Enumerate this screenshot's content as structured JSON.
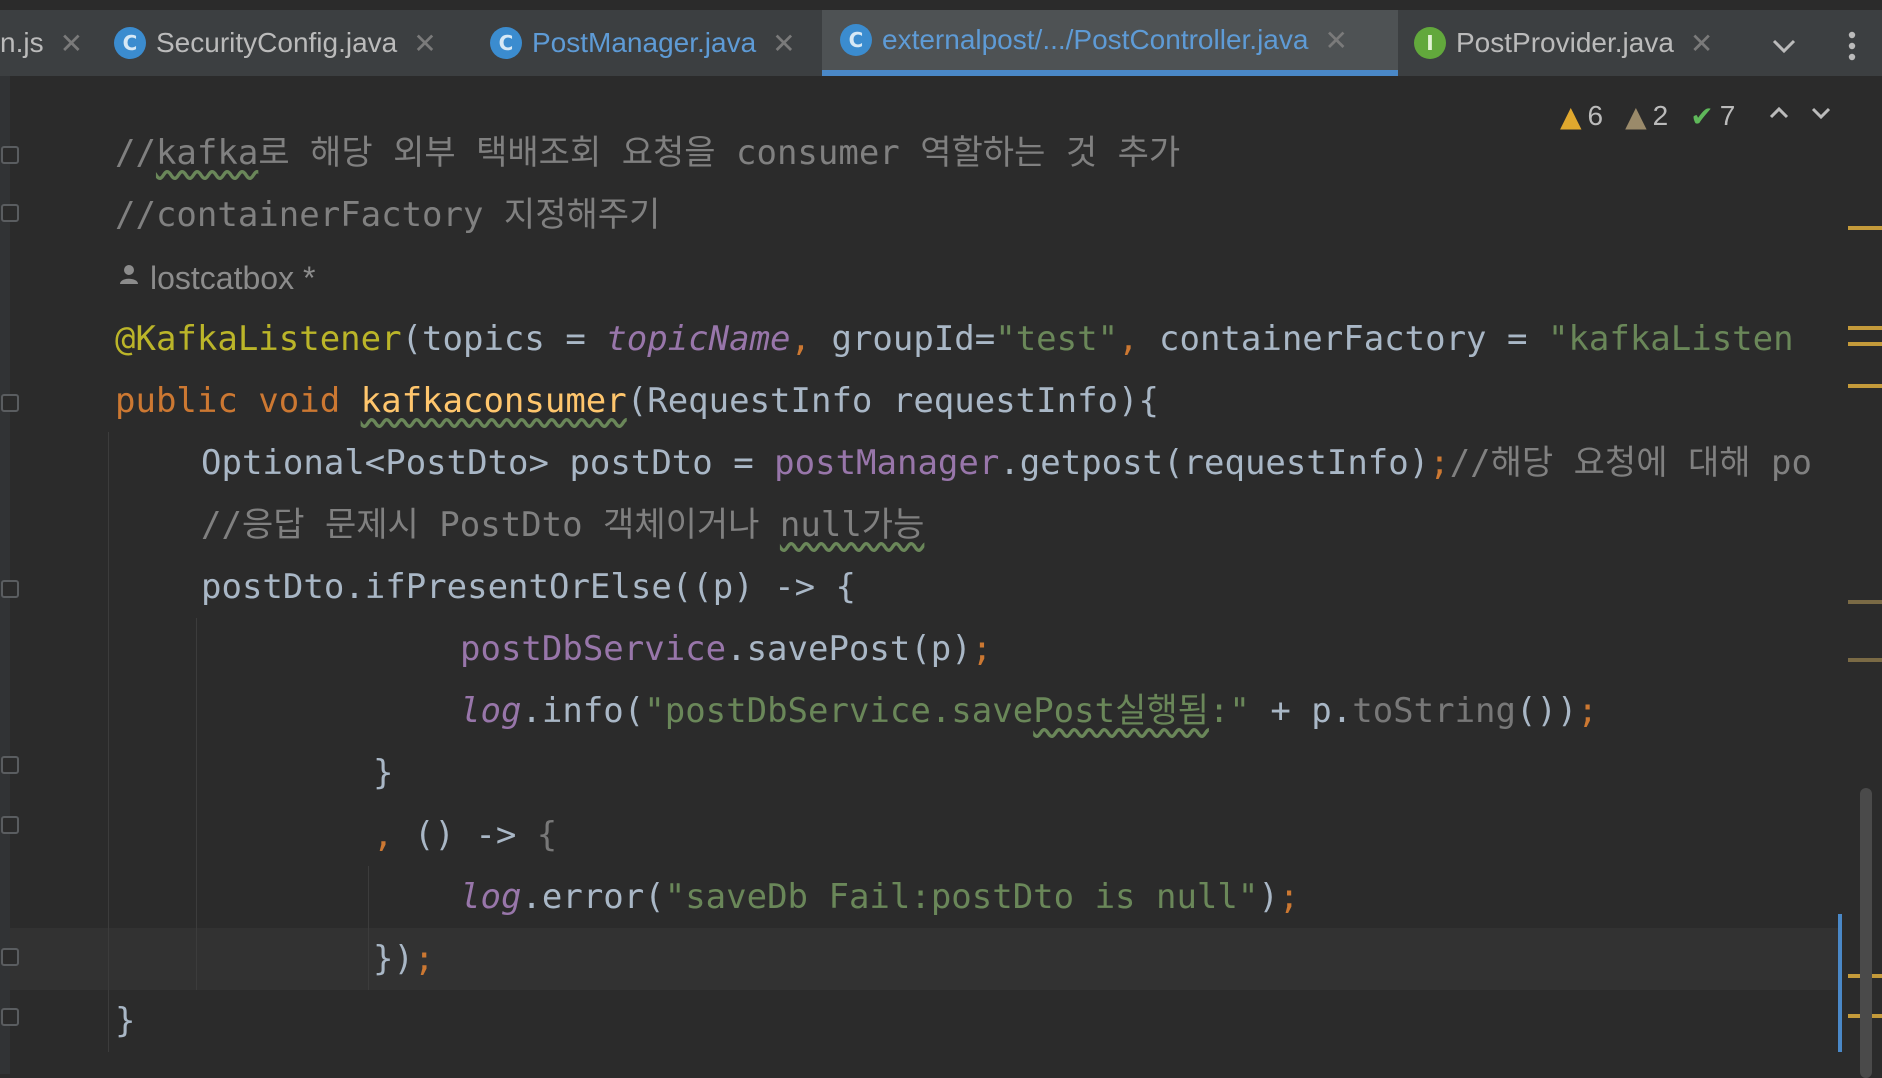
{
  "tabs": [
    {
      "label": "n.js",
      "badge": ""
    },
    {
      "label": "SecurityConfig.java",
      "badge": "C"
    },
    {
      "label": "PostManager.java",
      "badge": "C"
    },
    {
      "label": "externalpost/.../PostController.java",
      "badge": "C"
    },
    {
      "label": "PostProvider.java",
      "badge": "I"
    }
  ],
  "tab_close_glyph": "✕",
  "icons": {
    "tab_menu": "chevron-down-icon",
    "more": "more-vertical-icon",
    "inspect_up": "chevron-up-icon",
    "inspect_down": "chevron-down-icon",
    "author": "person-icon"
  },
  "inspections": {
    "warnings": "6",
    "weak_warnings": "2",
    "typos": "7"
  },
  "author": "lostcatbox *",
  "code": {
    "l1_a": "//",
    "l1_b": "kafka",
    "l1_c": "로 해당 외부 택배조회 요청을 consumer 역할하는 것 추가",
    "l2": "//containerFactory 지정해주기",
    "l4_ann": "@KafkaListener",
    "l4_a": "(topics = ",
    "l4_topic": "topicName",
    "l4_comma1": ", ",
    "l4_b": "groupId=",
    "l4_str1": "\"test\"",
    "l4_comma2": ", ",
    "l4_c": "containerFactory = ",
    "l4_str2": "\"kafkaListen",
    "l5_kw": "public void ",
    "l5_fn": "kafkaconsumer",
    "l5_rest": "(RequestInfo requestInfo){",
    "l6_a": "Optional<PostDto> postDto = ",
    "l6_fld": "postManager",
    "l6_b": ".getpost(requestInfo)",
    "l6_semi": ";",
    "l6_cmt": "//해당 요청에 대해 po",
    "l7_a": "//응답 문제시 PostDto 객체이거나 ",
    "l7_b": "null가능",
    "l8": "postDto.ifPresentOrElse((p) -> {",
    "l9_fld": "postDbService",
    "l9_rest": ".savePost(p)",
    "l9_semi": ";",
    "l10_log": "log",
    "l10_a": ".info(",
    "l10_str_a": "\"postDbService.save",
    "l10_str_b": "Post실행됨",
    "l10_str_c": ":\"",
    "l10_b": " + p.",
    "l10_dim": "toString",
    "l10_c": "())",
    "l10_semi": ";",
    "l11": "}",
    "l12_comma": ",",
    "l12_a": " () -> ",
    "l12_brace": "{",
    "l13_log": "log",
    "l13_a": ".error(",
    "l13_str": "\"saveDb Fail:postDto is null\"",
    "l13_b": ")",
    "l13_semi": ";",
    "l14_a": "})",
    "l14_semi": ";",
    "l15": "}"
  },
  "colors": {
    "background": "#2b2b2b",
    "keyword": "#cc7832",
    "string": "#6a8759",
    "comment": "#808080",
    "annotation": "#bbb529",
    "field": "#9876aa",
    "method_decl": "#ffc66d",
    "active_tab_underline": "#4a88c7"
  }
}
